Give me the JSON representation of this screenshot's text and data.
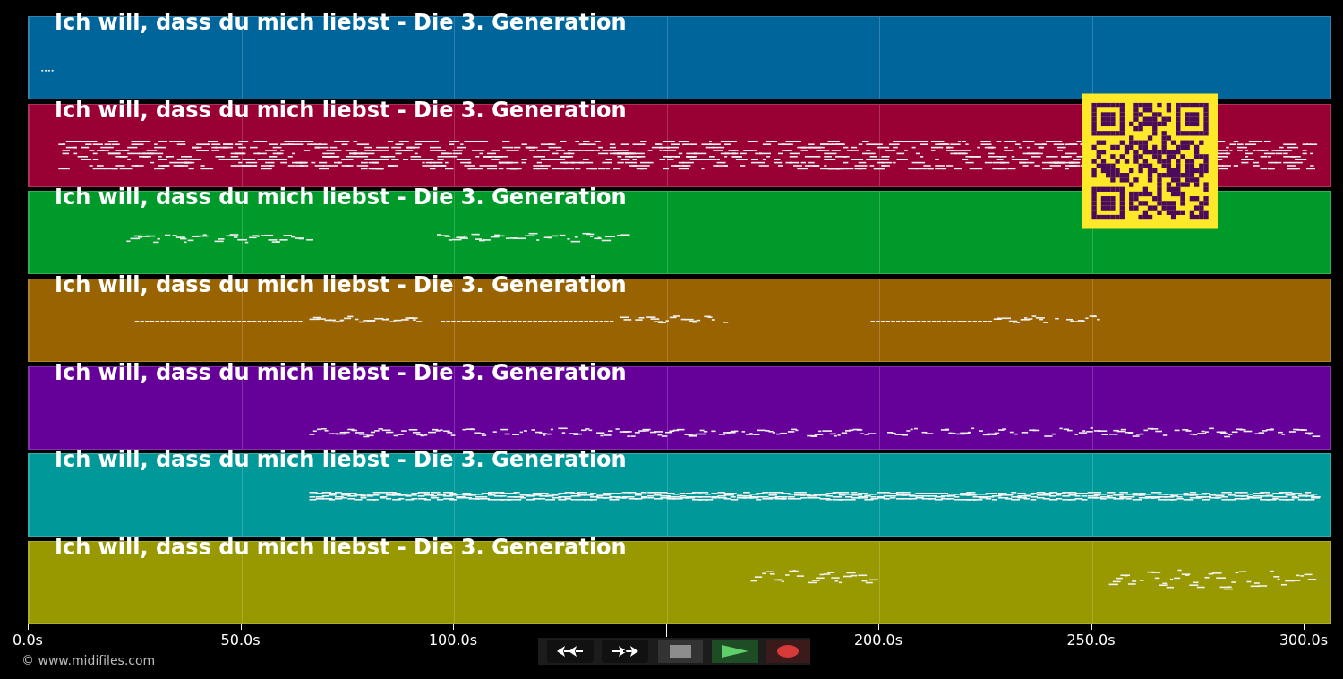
{
  "tracks": [
    {
      "title": "Ich will, dass du mich liebst - Die 3. Generation",
      "color": "#00659a"
    },
    {
      "title": "Ich will, dass du mich liebst - Die 3. Generation",
      "color": "#990033"
    },
    {
      "title": "Ich will, dass du mich liebst - Die 3. Generation",
      "color": "#009a2a"
    },
    {
      "title": "Ich will, dass du mich liebst - Die 3. Generation",
      "color": "#986300"
    },
    {
      "title": "Ich will, dass du mich liebst - Die 3. Generation",
      "color": "#650098"
    },
    {
      "title": "Ich will, dass du mich liebst - Die 3. Generation",
      "color": "#009898"
    },
    {
      "title": "Ich will, dass du mich liebst - Die 3. Generation",
      "color": "#989800"
    }
  ],
  "axis": {
    "ticks": [
      {
        "label": "0.0s",
        "covered": false
      },
      {
        "label": "50.0s",
        "covered": false
      },
      {
        "label": "100.0s",
        "covered": false
      },
      {
        "covered": true
      },
      {
        "label": "200.0s",
        "covered": false
      },
      {
        "label": "250.0s",
        "covered": false
      },
      {
        "label": "300.0s",
        "covered": false
      }
    ]
  },
  "transport": {
    "buttons": [
      {
        "kind": "rewind"
      },
      {
        "kind": "forward"
      },
      {
        "kind": "stop"
      },
      {
        "kind": "play"
      },
      {
        "kind": "record"
      }
    ]
  },
  "credit": "© www.midifiles.com"
}
